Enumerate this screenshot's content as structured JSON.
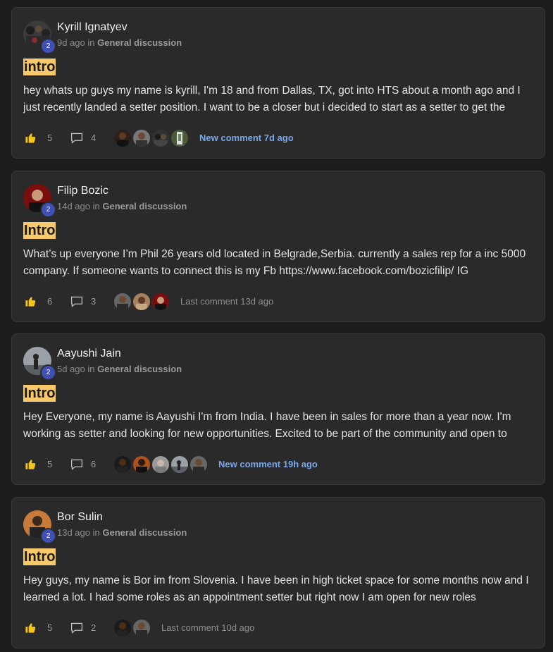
{
  "posts": [
    {
      "author": "Kyrill Ignatyev",
      "level": "2",
      "time": "9d ago",
      "in_word": "in",
      "category": "General discussion",
      "title": "intro",
      "body": "hey whats up guys my name is kyrill, I'm 18 and from Dallas, TX, got into HTS about a month ago and I just recently landed a setter position. I want to be a closer but i decided to start as a setter to get the",
      "likes": "5",
      "comments": "4",
      "last_comment": "New comment 7d ago",
      "last_comment_new": true
    },
    {
      "author": "Filip Bozic",
      "level": "2",
      "time": "14d ago",
      "in_word": "in",
      "category": "General discussion",
      "title": "Intro",
      "body": "What’s up everyone I’m Phil 26 years old located in Belgrade,Serbia. currently a sales rep for a inc 5000 company. If someone wants to connect this is my Fb https://www.facebook.com/bozicfilip/ IG",
      "likes": "6",
      "comments": "3",
      "last_comment": "Last comment 13d ago",
      "last_comment_new": false
    },
    {
      "author": "Aayushi Jain",
      "level": "2",
      "time": "5d ago",
      "in_word": "in",
      "category": "General discussion",
      "title": "Intro",
      "body": "Hey Everyone, my name is Aayushi I'm from India. I have been in sales for more than a year now. I'm working as setter and looking for new opportunities. Excited to be part of the community and open to",
      "likes": "5",
      "comments": "6",
      "last_comment": "New comment 19h ago",
      "last_comment_new": true
    },
    {
      "author": "Bor Sulin",
      "level": "2",
      "time": "13d ago",
      "in_word": "in",
      "category": "General discussion",
      "title": "Intro",
      "body": "Hey guys, my name is Bor im from Slovenia. I have been in high ticket space for some months now and I learned a lot. I had some roles as an appointment setter but right now I am open for new roles",
      "likes": "5",
      "comments": "2",
      "last_comment": "Last comment 10d ago",
      "last_comment_new": false
    }
  ],
  "icons": {
    "like": "thumbs-up-icon",
    "comment": "comment-bubble-icon"
  },
  "colors": {
    "title_highlight": "#f7c96a",
    "new_comment": "#7aa7e8",
    "level_badge": "#3f51b5",
    "card_bg": "#2a2a2a",
    "page_bg": "#1c1c1c"
  }
}
